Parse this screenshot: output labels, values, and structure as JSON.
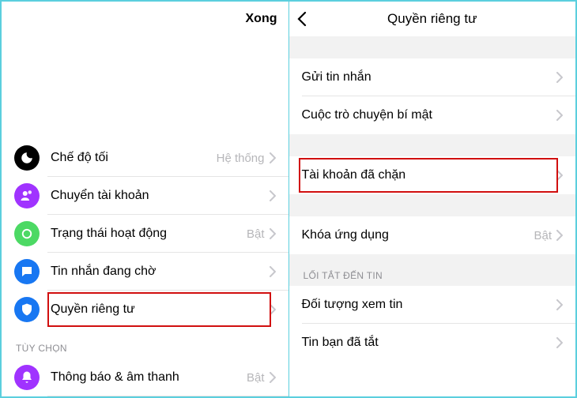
{
  "left": {
    "header": {
      "done": "Xong"
    },
    "rows": {
      "dark_mode": {
        "label": "Chế độ tối",
        "value": "Hệ thống"
      },
      "switch_account": {
        "label": "Chuyển tài khoản"
      },
      "active_status": {
        "label": "Trạng thái hoạt động",
        "value": "Bật"
      },
      "message_requests": {
        "label": "Tin nhắn đang chờ"
      },
      "privacy": {
        "label": "Quyền riêng tư"
      }
    },
    "sections": {
      "options": "TÙY CHỌN"
    },
    "rows2": {
      "notifications": {
        "label": "Thông báo & âm thanh",
        "value": "Bật"
      }
    }
  },
  "right": {
    "header": {
      "title": "Quyền riêng tư"
    },
    "rows": {
      "send_message": {
        "label": "Gửi tin nhắn"
      },
      "secret_chat": {
        "label": "Cuộc trò chuyện bí mật"
      },
      "blocked": {
        "label": "Tài khoản đã chặn"
      },
      "app_lock": {
        "label": "Khóa ứng dụng",
        "value": "Bật"
      }
    },
    "sections": {
      "story_shortcuts": "LỐI TẮT ĐẾN TIN"
    },
    "rows2": {
      "story_audience": {
        "label": "Đối tượng xem tin"
      },
      "muted_stories": {
        "label": "Tin bạn đã tắt"
      }
    }
  },
  "icons": {
    "dark": {
      "bg": "#000000"
    },
    "switch": {
      "bg": "#a033ff"
    },
    "active": {
      "bg": "#4cd964"
    },
    "requests": {
      "bg": "#1877f2"
    },
    "privacy": {
      "bg": "#1877f2"
    },
    "notif": {
      "bg": "#a033ff"
    }
  }
}
